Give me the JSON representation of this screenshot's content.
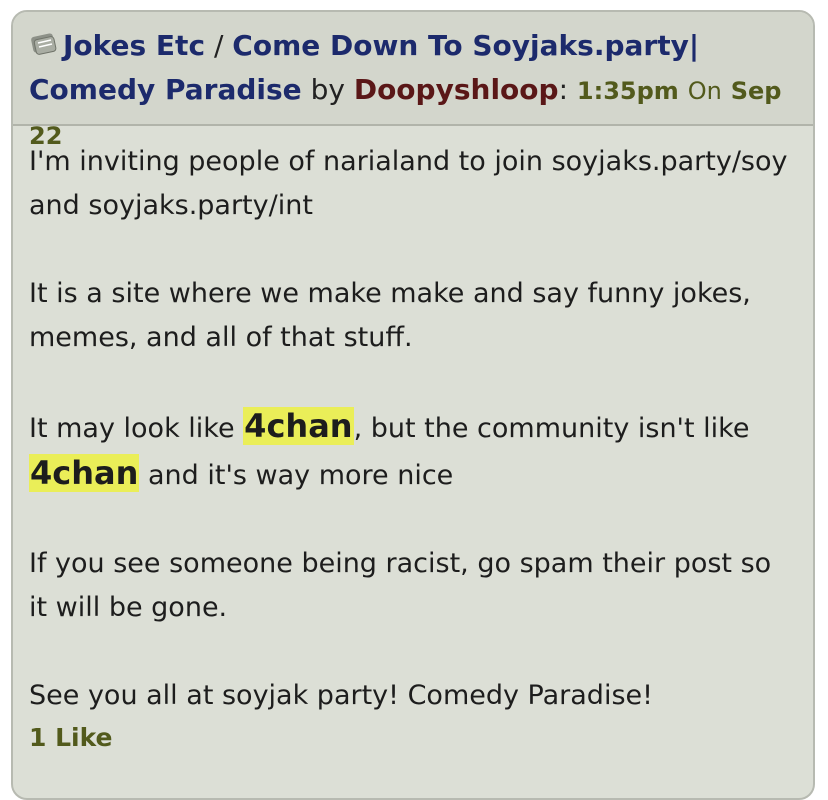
{
  "header": {
    "board": "Jokes Etc",
    "separator": "/",
    "topic_title": "Come Down To Soyjaks.party| Comedy Paradise",
    "by_label": "by",
    "author": "Doopyshloop",
    "colon": ":",
    "time": "1:35pm",
    "on_label": "On",
    "date": "Sep 22",
    "board_icon": "folder-icon"
  },
  "body": {
    "p1": "I'm inviting people of narialand to join soyjaks.party/soy and soyjaks.party/int",
    "p2": "It is a site where we make make and say funny jokes, memes, and all of that stuff.",
    "p3_before": "It may look like ",
    "p3_highlight1": "4chan",
    "p3_middle": ", but the community isn't like ",
    "p3_highlight2": "4chan",
    "p3_after": " and it's way more nice",
    "p4": "If you see someone being racist, go spam their post so it will be gone.",
    "p5": "See you all at soyjak party! Comedy Paradise!"
  },
  "footer": {
    "likes": "1 Like"
  },
  "colors": {
    "link": "#1c2a6c",
    "author": "#5a1717",
    "meta": "#525a1c",
    "highlight": "#eaee58",
    "post_bg": "#dcdfd6",
    "header_bg": "#d3d6cc"
  }
}
